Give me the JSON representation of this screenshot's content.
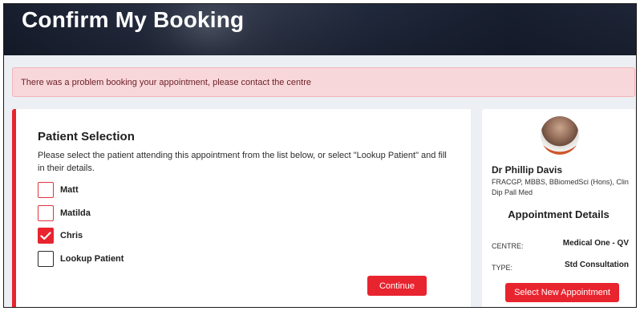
{
  "header": {
    "title": "Confirm My Booking"
  },
  "alert": {
    "message": "There was a problem booking your appointment, please contact the centre"
  },
  "patient_selection": {
    "title": "Patient Selection",
    "description": "Please select the patient attending this appointment from the list below, or select \"Lookup Patient\" and fill in their details.",
    "options": [
      {
        "label": "Matt",
        "checked": false
      },
      {
        "label": "Matilda",
        "checked": false
      },
      {
        "label": "Chris",
        "checked": true
      },
      {
        "label": "Lookup Patient",
        "checked": false
      }
    ],
    "continue_label": "Continue"
  },
  "doctor": {
    "name": "Dr Phillip Davis",
    "qualifications": "FRACGP, MBBS, BBiomedSci (Hons), Clin Dip Pall Med"
  },
  "appointment": {
    "title": "Appointment Details",
    "centre_label": "CENTRE:",
    "centre_value": "Medical One - QV",
    "type_label": "TYPE:",
    "type_value": "Std Consultation",
    "select_new_label": "Select New Appointment"
  },
  "colors": {
    "accent": "#e8242f",
    "alert_bg": "#f8d7da",
    "page_bg": "#eceff3"
  }
}
